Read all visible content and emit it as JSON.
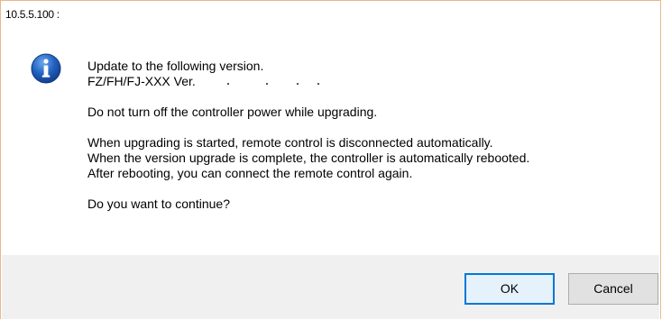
{
  "window": {
    "title": "10.5.5.100 :"
  },
  "dialog": {
    "icon": "info-icon",
    "messages": [
      "Update to the following version.",
      "FZ/FH/FJ-XXX Ver.",
      "Do not turn off the controller power while upgrading.",
      "When upgrading is started, remote control is disconnected automatically.",
      "When the version upgrade is complete, the controller is automatically rebooted.",
      "After rebooting, you can connect the remote control again.",
      "Do you want to continue?"
    ]
  },
  "buttons": {
    "ok_label": "OK",
    "cancel_label": "Cancel"
  },
  "colors": {
    "window_border": "#e4b98a",
    "footer_bg": "#f0f0f0",
    "ok_border": "#0078d7",
    "info_icon": "#1c5db8"
  }
}
